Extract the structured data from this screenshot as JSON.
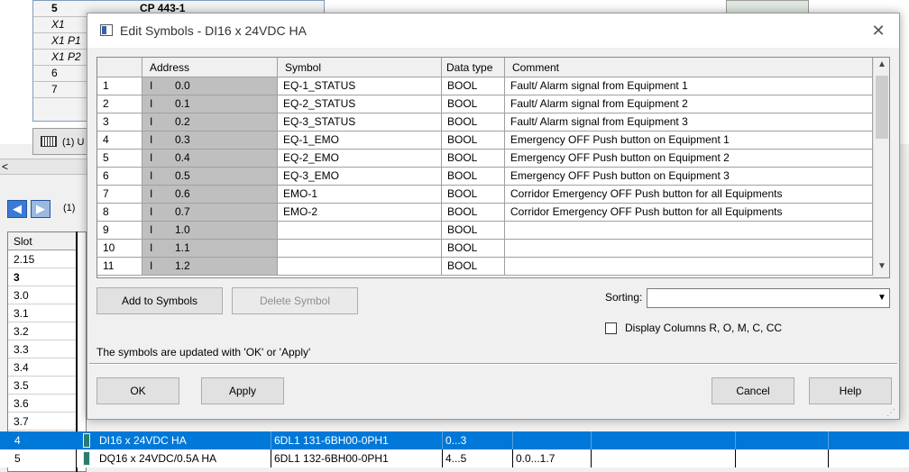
{
  "background": {
    "rack_rows": [
      {
        "label": "5",
        "module": "CP 443-1",
        "bold": true
      },
      {
        "label": "X1",
        "module": "",
        "bold": false
      },
      {
        "label": "X1 P1",
        "module": "",
        "bold": false
      },
      {
        "label": "X1 P2",
        "module": "",
        "bold": false
      },
      {
        "label": "6",
        "module": "",
        "bold": false
      },
      {
        "label": "7",
        "module": "",
        "bold": false
      }
    ],
    "rack_tab_label": "(1) U",
    "hscroll_arrow": "<",
    "nav_label": "(1)",
    "slot_header": "Slot",
    "slots": [
      "2.15",
      "3",
      "3.0",
      "3.1",
      "3.2",
      "3.3",
      "3.4",
      "3.5",
      "3.6",
      "3.7"
    ],
    "module_rows": [
      {
        "slot": "4",
        "name": "DI16 x 24VDC HA",
        "order": "6DL1 131-6BH00-0PH1",
        "address": "0...3",
        "q_address": "",
        "selected": true
      },
      {
        "slot": "5",
        "name": "DQ16 x 24VDC/0.5A HA",
        "order": "6DL1 132-6BH00-0PH1",
        "address": "4...5",
        "q_address": "0.0...1.7",
        "selected": false
      }
    ]
  },
  "dialog": {
    "title": "Edit Symbols - DI16 x 24VDC HA",
    "close_icon": "close-icon",
    "columns": [
      "",
      "Address",
      "Symbol",
      "Data type",
      "Comment"
    ],
    "rows": [
      {
        "num": "1",
        "io": "I",
        "addr": "0.0",
        "symbol": "EQ-1_STATUS",
        "type": "BOOL",
        "comment": "Fault/ Alarm signal from Equipment 1"
      },
      {
        "num": "2",
        "io": "I",
        "addr": "0.1",
        "symbol": "EQ-2_STATUS",
        "type": "BOOL",
        "comment": "Fault/ Alarm signal from Equipment 2"
      },
      {
        "num": "3",
        "io": "I",
        "addr": "0.2",
        "symbol": "EQ-3_STATUS",
        "type": "BOOL",
        "comment": "Fault/ Alarm signal from Equipment 3"
      },
      {
        "num": "4",
        "io": "I",
        "addr": "0.3",
        "symbol": "EQ-1_EMO",
        "type": "BOOL",
        "comment": "Emergency OFF Push button on Equipment 1"
      },
      {
        "num": "5",
        "io": "I",
        "addr": "0.4",
        "symbol": "EQ-2_EMO",
        "type": "BOOL",
        "comment": "Emergency OFF Push button on Equipment 2"
      },
      {
        "num": "6",
        "io": "I",
        "addr": "0.5",
        "symbol": "EQ-3_EMO",
        "type": "BOOL",
        "comment": "Emergency OFF Push button on Equipment 3"
      },
      {
        "num": "7",
        "io": "I",
        "addr": "0.6",
        "symbol": "EMO-1",
        "type": "BOOL",
        "comment": "Corridor Emergency OFF Push button for all Equipments"
      },
      {
        "num": "8",
        "io": "I",
        "addr": "0.7",
        "symbol": "EMO-2",
        "type": "BOOL",
        "comment": "Corridor Emergency OFF Push button for all Equipments"
      },
      {
        "num": "9",
        "io": "I",
        "addr": "1.0",
        "symbol": "",
        "type": "BOOL",
        "comment": ""
      },
      {
        "num": "10",
        "io": "I",
        "addr": "1.1",
        "symbol": "",
        "type": "BOOL",
        "comment": ""
      },
      {
        "num": "11",
        "io": "I",
        "addr": "1.2",
        "symbol": "",
        "type": "BOOL",
        "comment": ""
      }
    ],
    "add_button": "Add to Symbols",
    "delete_button": "Delete Symbol",
    "sorting_label": "Sorting:",
    "sorting_value": "",
    "display_columns_label": "Display Columns R, O, M, C, CC",
    "display_columns_checked": false,
    "status_text": "The symbols are updated with 'OK' or  'Apply'",
    "ok_button": "OK",
    "apply_button": "Apply",
    "cancel_button": "Cancel",
    "help_button": "Help"
  },
  "colors": {
    "selection": "#0078d7",
    "address_cell": "#bfbfbf",
    "dialog_bg": "#f0f0f0"
  }
}
